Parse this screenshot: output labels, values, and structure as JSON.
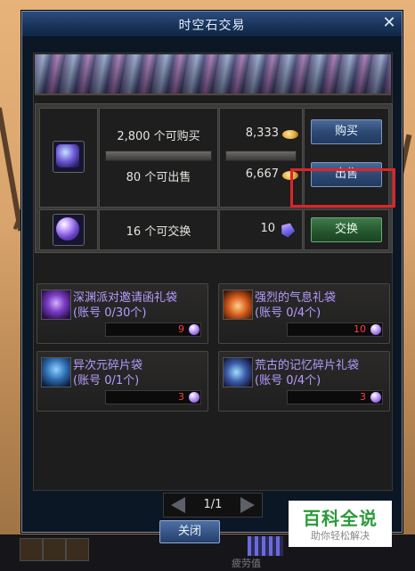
{
  "window": {
    "title": "时空石交易",
    "close_glyph": "✕"
  },
  "exchange": {
    "buy_limit_text": "2,800 个可购买",
    "sell_limit_text": "80 个可出售",
    "exchange_limit_text": "16 个可交换",
    "buy_price": "8,333",
    "sell_price": "6,667",
    "exchange_cost": "10",
    "buy_button": "购买",
    "sell_button": "出售",
    "exchange_button": "交换"
  },
  "packages": [
    {
      "title": "深渊派对邀请函礼袋",
      "limit": "(账号 0/30个)",
      "price": "9",
      "icon": "skull-icon"
    },
    {
      "title": "强烈的气息礼袋",
      "limit": "(账号 0/4个)",
      "price": "10",
      "icon": "flame-icon"
    },
    {
      "title": "异次元碎片袋",
      "limit": "(账号 0/1个)",
      "price": "3",
      "icon": "warrior-icon"
    },
    {
      "title": "荒古的记忆碎片礼袋",
      "limit": "(账号 0/4个)",
      "price": "3",
      "icon": "armor-icon"
    }
  ],
  "pager": {
    "page": "1/1"
  },
  "footer": {
    "close_button": "关闭"
  },
  "hud": {
    "label": "疲劳值"
  },
  "watermark": {
    "main": "百科全说",
    "sub": "助你轻松解决"
  },
  "colors": {
    "highlight": "#e02428",
    "package_text": "#b49cff",
    "price_text": "#ff3b3b"
  }
}
